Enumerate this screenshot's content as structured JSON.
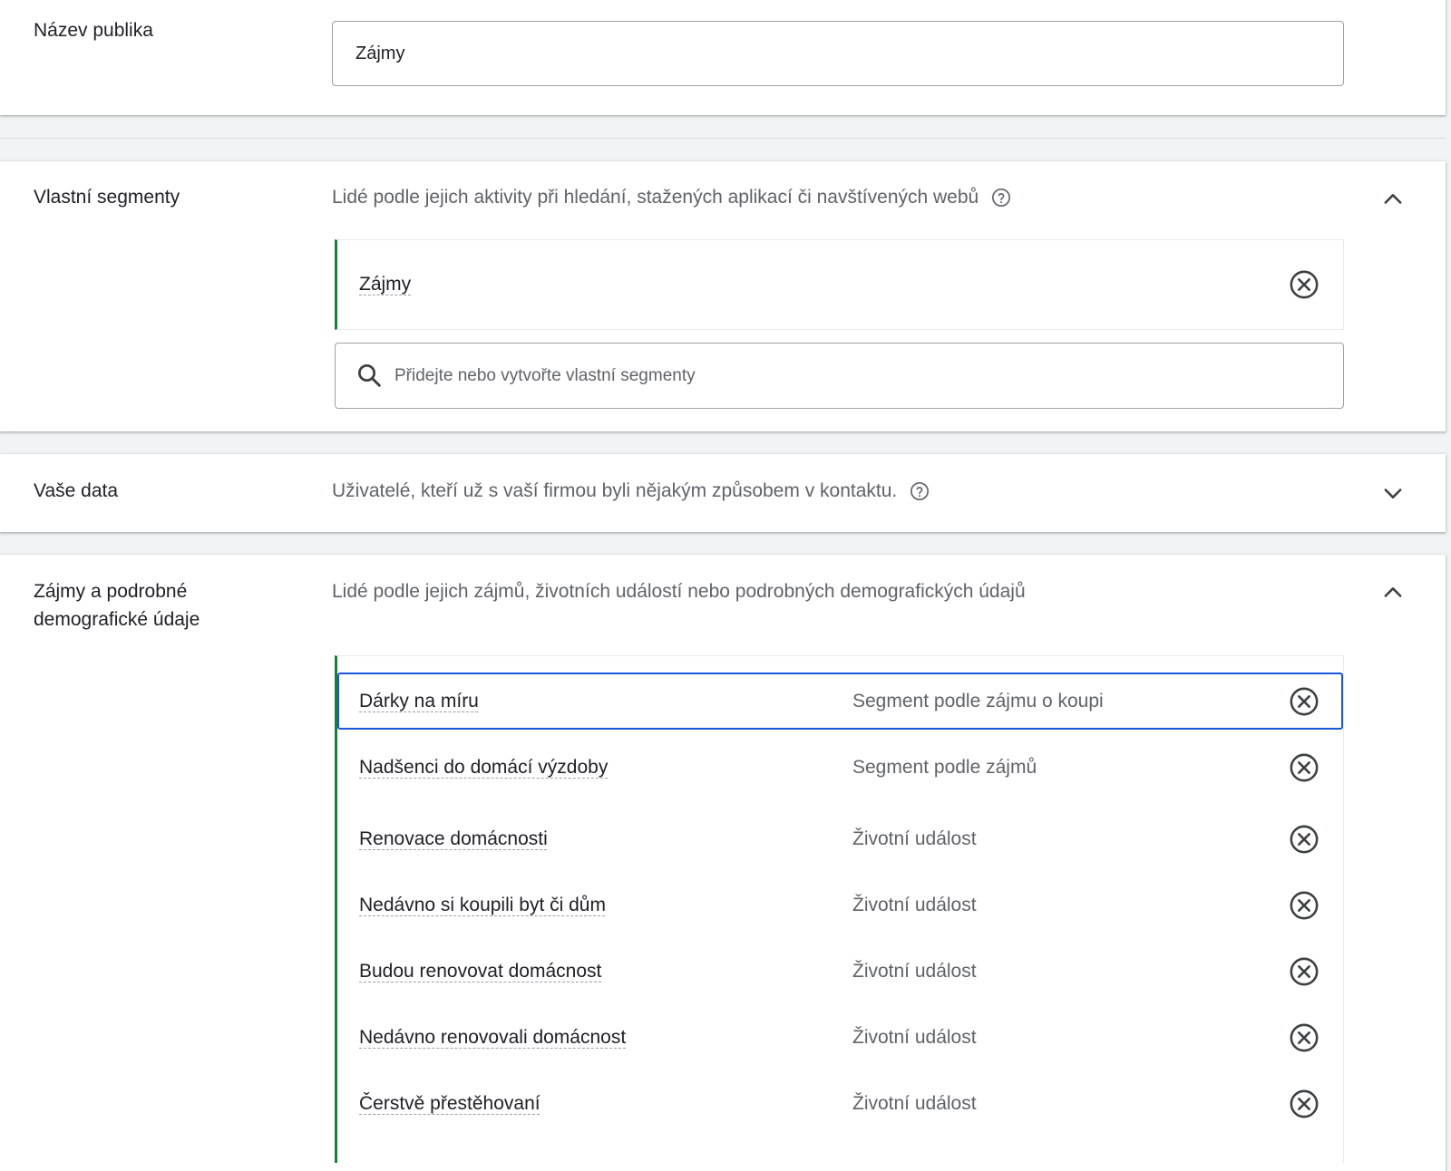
{
  "audience_name": {
    "label": "Název publika",
    "value": "Zájmy"
  },
  "custom_segments": {
    "label": "Vlastní segmenty",
    "description": "Lidé podle jejich aktivity při hledání, stažených aplikací či navštívených webů",
    "help_icon": "help-circle-icon",
    "expanded": true,
    "items": [
      {
        "name": "Zájmy"
      }
    ],
    "search": {
      "icon": "search-icon",
      "placeholder": "Přidejte nebo vytvořte vlastní segmenty"
    }
  },
  "your_data": {
    "label": "Vaše data",
    "description": "Uživatelé, kteří už s vaší firmou byli nějakým způsobem v kontaktu.",
    "help_icon": "help-circle-icon",
    "expanded": false
  },
  "interests": {
    "label_line1": "Zájmy a podrobné",
    "label_line2": "demografické údaje",
    "description": "Lidé podle jejich zájmů, životních událostí nebo podrobných demografických údajů",
    "expanded": true,
    "items": [
      {
        "name": "Dárky na míru",
        "type": "Segment podle zájmu o koupi"
      },
      {
        "name": "Nadšenci do domácí výzdoby",
        "type": "Segment podle zájmů"
      },
      {
        "name": "Renovace domácnosti",
        "type": "Životní událost"
      },
      {
        "name": "Nedávno si koupili byt či dům",
        "type": "Životní událost"
      },
      {
        "name": "Budou renovovat domácnost",
        "type": "Životní událost"
      },
      {
        "name": "Nedávno renovovali domácnost",
        "type": "Životní událost"
      },
      {
        "name": "Čerstvě přestěhovaní",
        "type": "Životní událost"
      }
    ]
  },
  "colors": {
    "accent_green": "#188038",
    "focus_blue": "#1a56db",
    "secondary_text": "#5f6368"
  }
}
